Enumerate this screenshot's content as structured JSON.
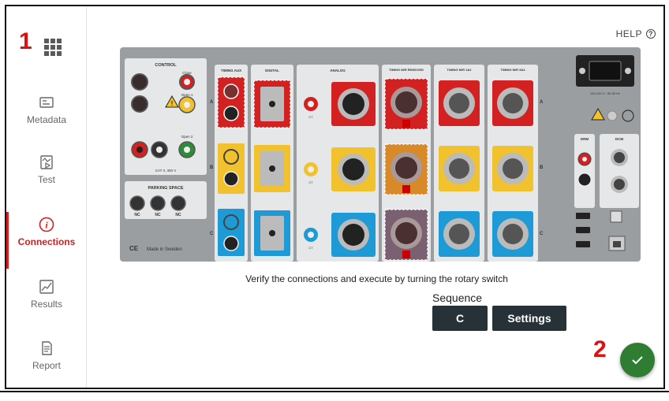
{
  "annotations": {
    "marker_1": "1",
    "marker_2": "2"
  },
  "sidebar": {
    "items": [
      {
        "label": "Metadata",
        "icon": "metadata-icon"
      },
      {
        "label": "Test",
        "icon": "test-icon"
      },
      {
        "label": "Connections",
        "icon": "info-icon"
      },
      {
        "label": "Results",
        "icon": "results-icon"
      },
      {
        "label": "Report",
        "icon": "report-icon"
      }
    ],
    "active": "Connections"
  },
  "header": {
    "help": "HELP"
  },
  "panel": {
    "sections": {
      "control": "CONTROL",
      "parking": "PARKING SPACE",
      "timing_aux": "TIMING AUX",
      "digital": "DIGITAL",
      "analog": "ANALOG",
      "timing_m_removed": "TIMING M/R REMOVED",
      "timing_12": "TIMING M/R 1&2",
      "timing_34": "TIMING M/R 3&4",
      "drm": "DRM",
      "dcm": "DCM"
    },
    "row_labels": [
      "A",
      "B",
      "C"
    ],
    "control_labels": {
      "close": "Close",
      "open1": "Open 1",
      "open2": "Open 2",
      "cat": "CAT II, 300 V"
    },
    "nc_labels": [
      "NC",
      "NC",
      "NC"
    ],
    "made_in": "Made in Sweden",
    "ce": "CE",
    "cat_label": "CAT II, 300 V",
    "ct_label": "CT",
    "power_text": "100-240 V~ 50-60 Hz"
  },
  "main": {
    "instruction": "Verify the connections and execute by turning the rotary switch",
    "sequence_label": "Sequence",
    "sequence_value": "C",
    "settings_label": "Settings"
  },
  "colors": {
    "accent": "#d81b1b",
    "button_dark": "#263238",
    "fab_green": "#2e7d32",
    "panel_gray": "#9b9ea1",
    "red": "#d32020",
    "yellow": "#f2c12e",
    "blue": "#1e9ad6"
  }
}
